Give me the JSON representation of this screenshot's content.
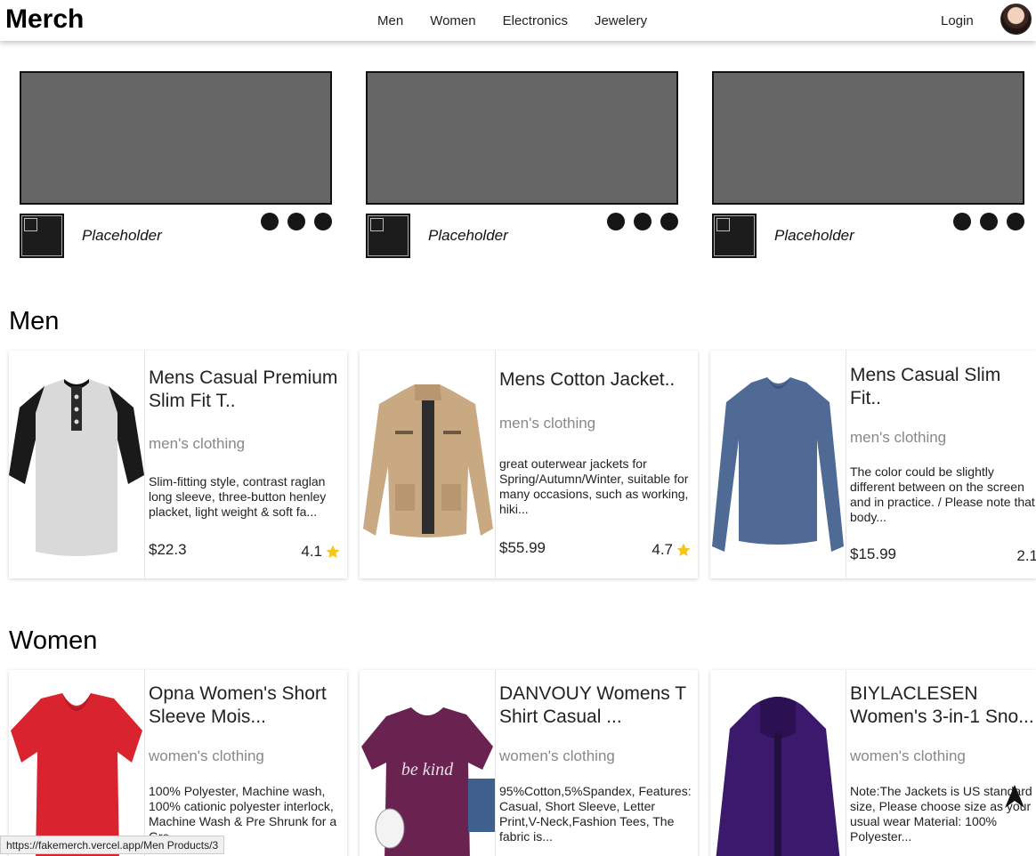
{
  "header": {
    "brand": "Merch",
    "nav": [
      "Men",
      "Women",
      "Electronics",
      "Jewelery"
    ],
    "login": "Login",
    "avatar_icon": "user-avatar"
  },
  "placeholders": [
    {
      "label": "Placeholder"
    },
    {
      "label": "Placeholder"
    },
    {
      "label": "Placeholder"
    }
  ],
  "men": {
    "title": "Men",
    "products": [
      {
        "title": "Mens Casual Premium Slim Fit T..",
        "category": "men's clothing",
        "description": "Slim-fitting style, contrast raglan long sleeve, three-button henley placket, light weight & soft fa...",
        "price": "$22.3",
        "rating": "4.1",
        "image_icon": "henley-shirt-image"
      },
      {
        "title": "Mens Cotton Jacket..",
        "category": "men's clothing",
        "description": "great outerwear jackets for Spring/Autumn/Winter, suitable for many occasions, such as working, hiki...",
        "price": "$55.99",
        "rating": "4.7",
        "image_icon": "jacket-image"
      },
      {
        "title": "Mens Casual Slim Fit..",
        "category": "men's clothing",
        "description": "The color could be slightly different between on the screen and in practice. / Please note that body...",
        "price": "$15.99",
        "rating": "2.1",
        "image_icon": "long-sleeve-shirt-image"
      }
    ]
  },
  "women": {
    "title": "Women",
    "products": [
      {
        "title": "Opna Women's Short Sleeve Mois...",
        "category": "women's clothing",
        "description": "100% Polyester, Machine wash, 100% cationic polyester interlock, Machine Wash & Pre Shrunk for a Gre...",
        "image_icon": "red-tshirt-image"
      },
      {
        "title": "DANVOUY Womens T Shirt Casual ...",
        "category": "women's clothing",
        "description": "95%Cotton,5%Spandex, Features: Casual, Short Sleeve, Letter Print,V-Neck,Fashion Tees, The fabric is...",
        "image_icon": "purple-tshirt-image",
        "print": "be kind"
      },
      {
        "title": "BIYLACLESEN Women's 3-in-1 Sno...",
        "category": "women's clothing",
        "description": "Note:The Jackets is US standard size, Please choose size as your usual wear Material: 100% Polyester...",
        "image_icon": "purple-jacket-image"
      }
    ]
  },
  "status_url": "https://fakemerch.vercel.app/Men Products/3",
  "colors": {
    "star": "#f5c518",
    "placeholder": "#666666",
    "category_text": "#888888"
  }
}
